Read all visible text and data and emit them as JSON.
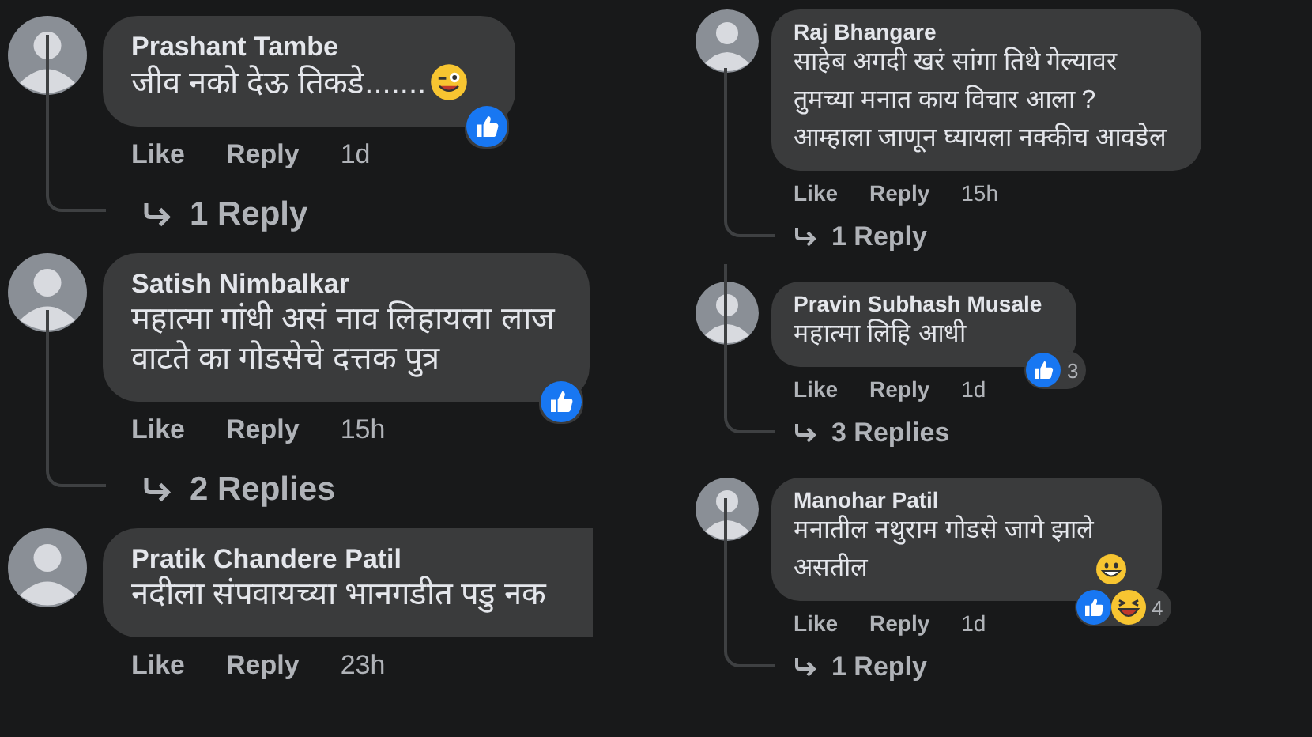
{
  "columns": [
    {
      "kind": "large",
      "comments": [
        {
          "author": "Prashant Tambe",
          "text": "जीव नको देऊ तिकडे.......",
          "emoji": {
            "kind": "wink"
          },
          "reactions": [
            {
              "kind": "like"
            }
          ],
          "like": "Like",
          "reply": "Reply",
          "time": "1d",
          "replies": "1 Reply"
        },
        {
          "author": "Satish Nimbalkar",
          "text": "महात्मा गांधी असं नाव लिहायला लाज\nवाटते का गोडसेचे दत्तक पुत्र",
          "reactions": [
            {
              "kind": "like"
            }
          ],
          "like": "Like",
          "reply": "Reply",
          "time": "15h",
          "replies": "2 Replies"
        },
        {
          "author": "Pratik Chandere Patil",
          "text": "नदीला संपवायच्या भानगडीत पडु नक",
          "cut": true,
          "like": "Like",
          "reply": "Reply",
          "time": "23h"
        }
      ]
    },
    {
      "kind": "small",
      "comments": [
        {
          "author": "Raj Bhangare",
          "text": "साहेब अगदी खरं सांगा तिथे गेल्यावर\nतुमच्या मनात काय विचार आला ?\nआम्हाला जाणून घ्यायला नक्कीच आवडेल",
          "like": "Like",
          "reply": "Reply",
          "time": "15h",
          "replies": "1 Reply"
        },
        {
          "author": "Pravin Subhash Musale",
          "text": "महात्मा लिहि आधी",
          "reactions": [
            {
              "kind": "like"
            }
          ],
          "count": "3",
          "like": "Like",
          "reply": "Reply",
          "time": "1d",
          "replies": "3 Replies"
        },
        {
          "author": "Manohar Patil",
          "text": "मनातील नथुराम गोडसे जागे झाले\nअसतील",
          "emoji": {
            "kind": "grin"
          },
          "reactions": [
            {
              "kind": "like"
            },
            {
              "kind": "haha"
            }
          ],
          "count": "4",
          "like": "Like",
          "reply": "Reply",
          "time": "1d",
          "replies": "1 Reply"
        }
      ]
    }
  ]
}
